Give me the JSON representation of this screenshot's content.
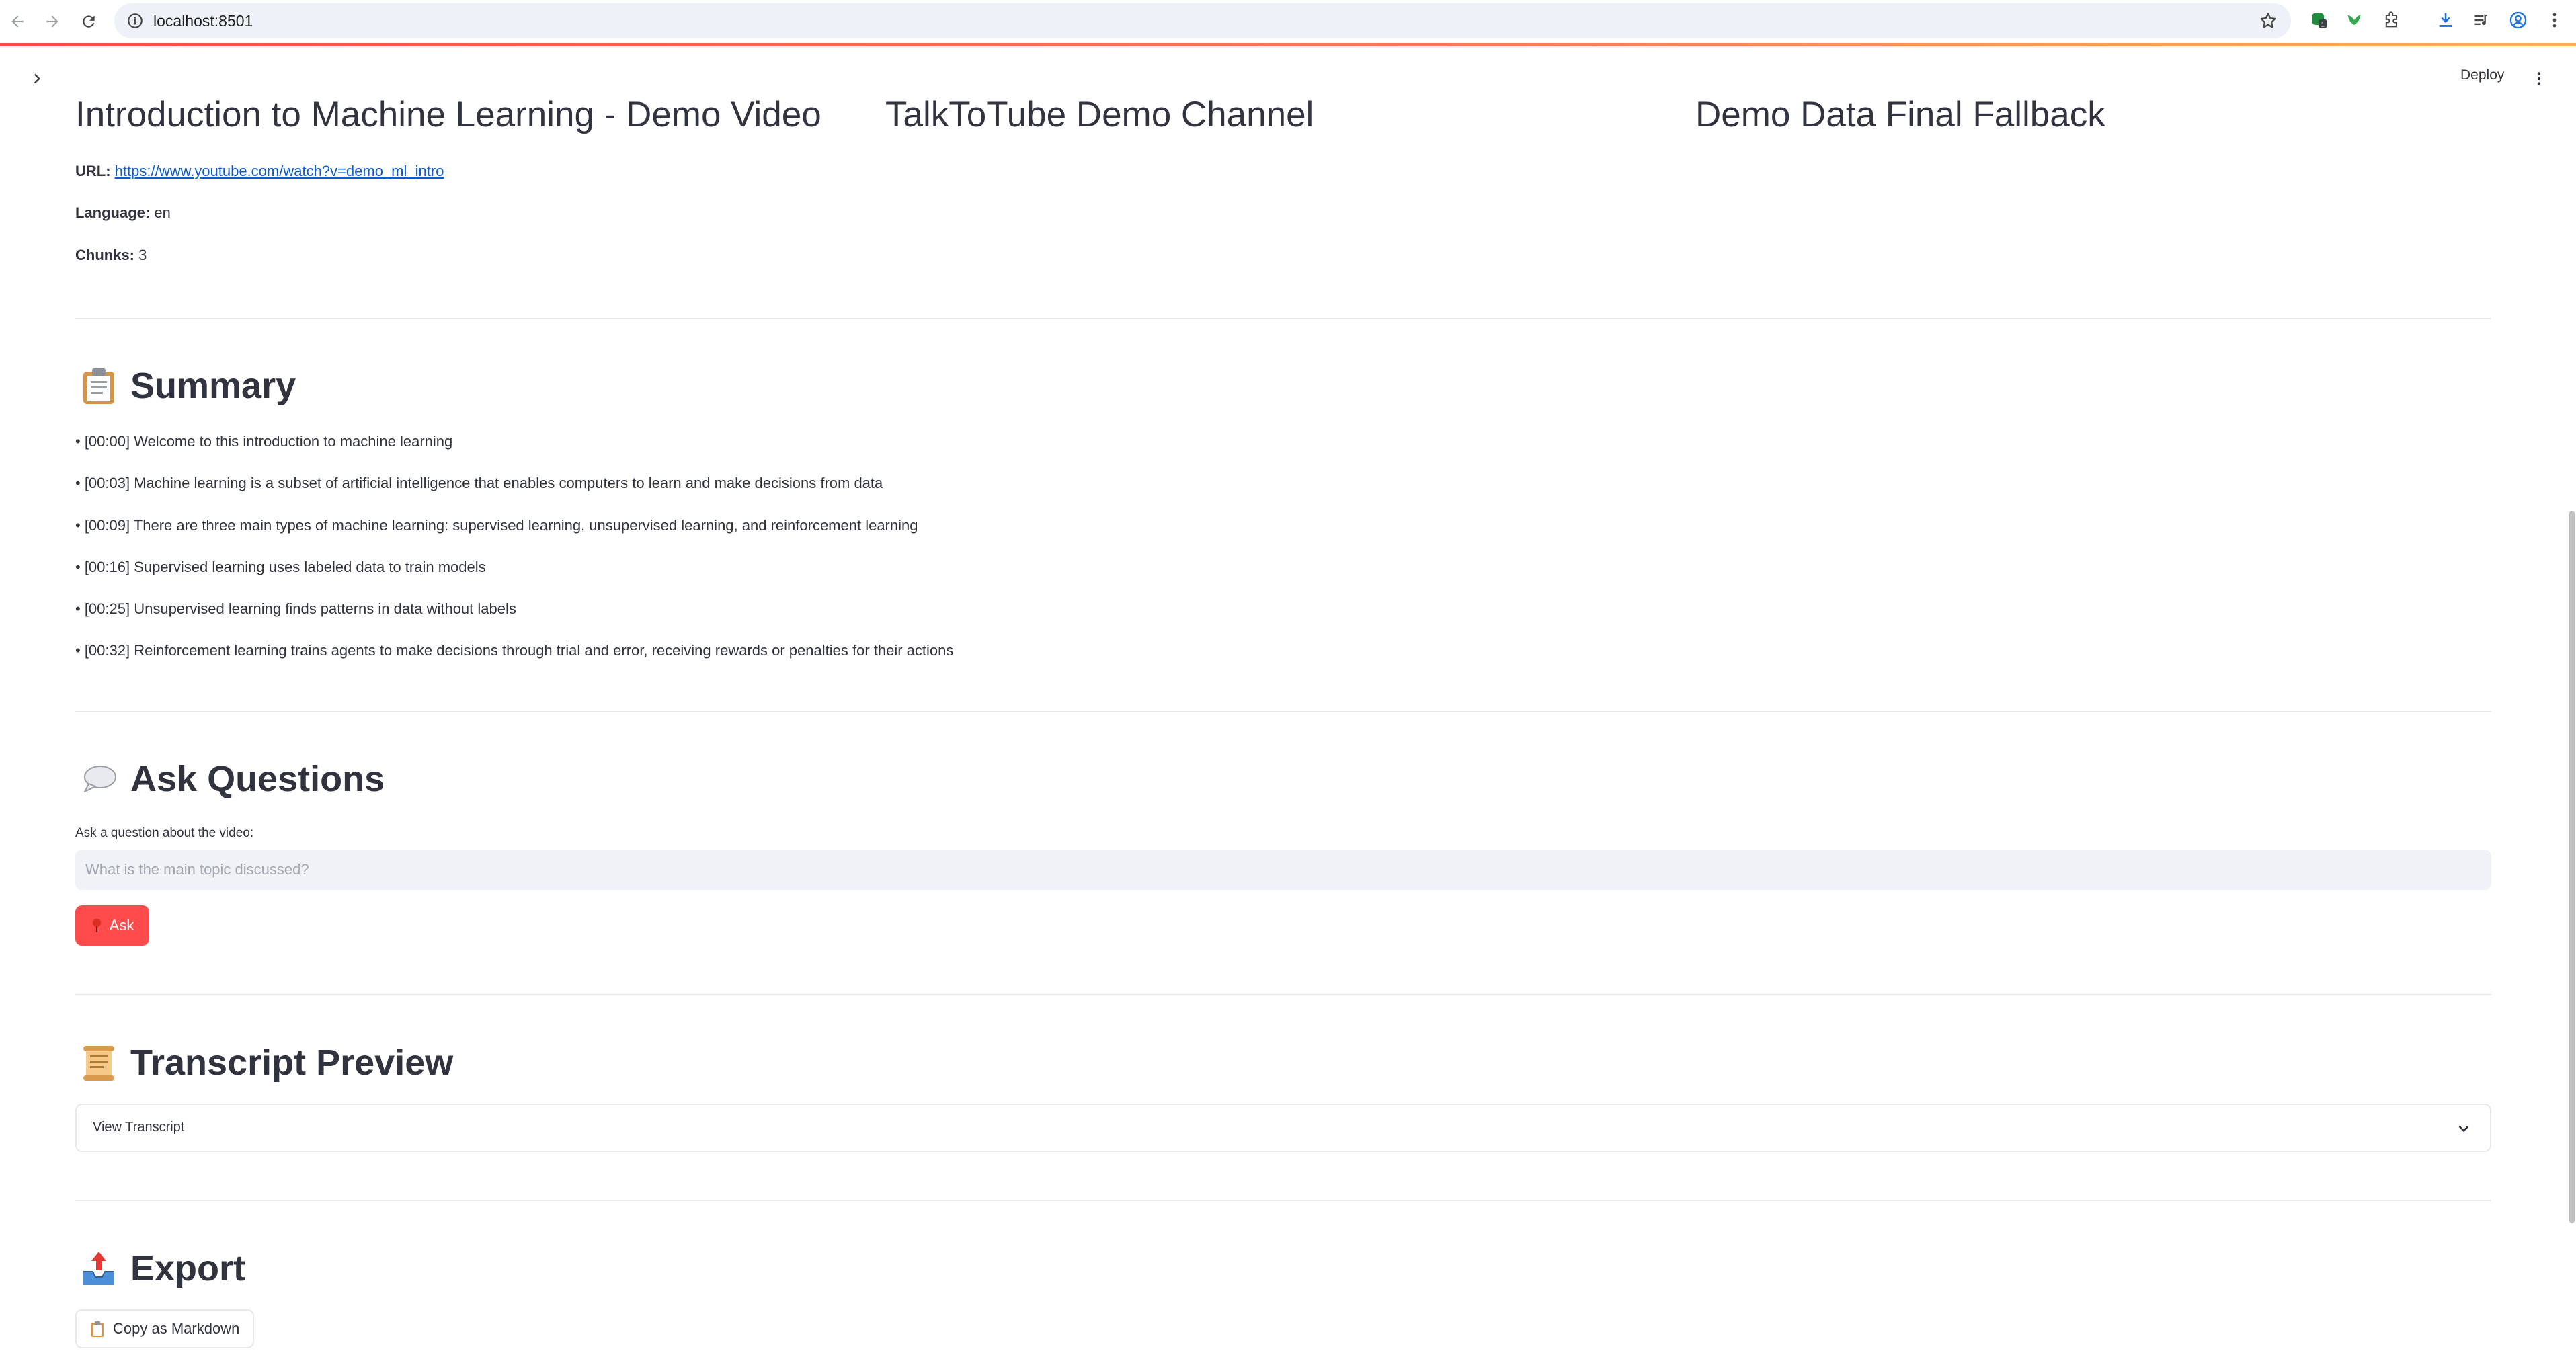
{
  "browser": {
    "url": "localhost:8501"
  },
  "app_header": {
    "deploy_label": "Deploy"
  },
  "video": {
    "title": "Introduction to Machine Learning - Demo Video",
    "channel": "TalkToTube Demo Channel",
    "source": "Demo Data Final Fallback",
    "url_label": "URL:",
    "url": "https://www.youtube.com/watch?v=demo_ml_intro",
    "language_label": "Language:",
    "language": "en",
    "chunks_label": "Chunks:",
    "chunks": "3"
  },
  "summary": {
    "heading": "Summary",
    "items": [
      "• [00:00] Welcome to this introduction to machine learning",
      "• [00:03] Machine learning is a subset of artificial intelligence that enables computers to learn and make decisions from data",
      "• [00:09] There are three main types of machine learning: supervised learning, unsupervised learning, and reinforcement learning",
      "• [00:16] Supervised learning uses labeled data to train models",
      "• [00:25] Unsupervised learning finds patterns in data without labels",
      "• [00:32] Reinforcement learning trains agents to make decisions through trial and error, receiving rewards or penalties for their actions"
    ]
  },
  "questions": {
    "heading": "Ask Questions",
    "input_label": "Ask a question about the video:",
    "placeholder": "What is the main topic discussed?",
    "ask_label": "Ask"
  },
  "transcript": {
    "heading": "Transcript Preview",
    "expander_label": "View Transcript"
  },
  "export": {
    "heading": "Export",
    "copy_label": "Copy as Markdown"
  },
  "colors": {
    "primary": "#ff4b4b",
    "text": "#31333f",
    "link": "#0b5cd7",
    "input_bg": "#f0f2f6",
    "divider": "#e6e8ec"
  },
  "icons": [
    "back-icon",
    "forward-icon",
    "reload-icon",
    "site-info-icon",
    "bookmark-star-icon",
    "extension-icon",
    "download-icon",
    "profile-icon",
    "menu-icon",
    "clipboard-emoji-icon",
    "speech-bubble-emoji-icon",
    "scroll-emoji-icon",
    "outbox-tray-emoji-icon",
    "pushpin-icon",
    "chevron-down-icon"
  ]
}
